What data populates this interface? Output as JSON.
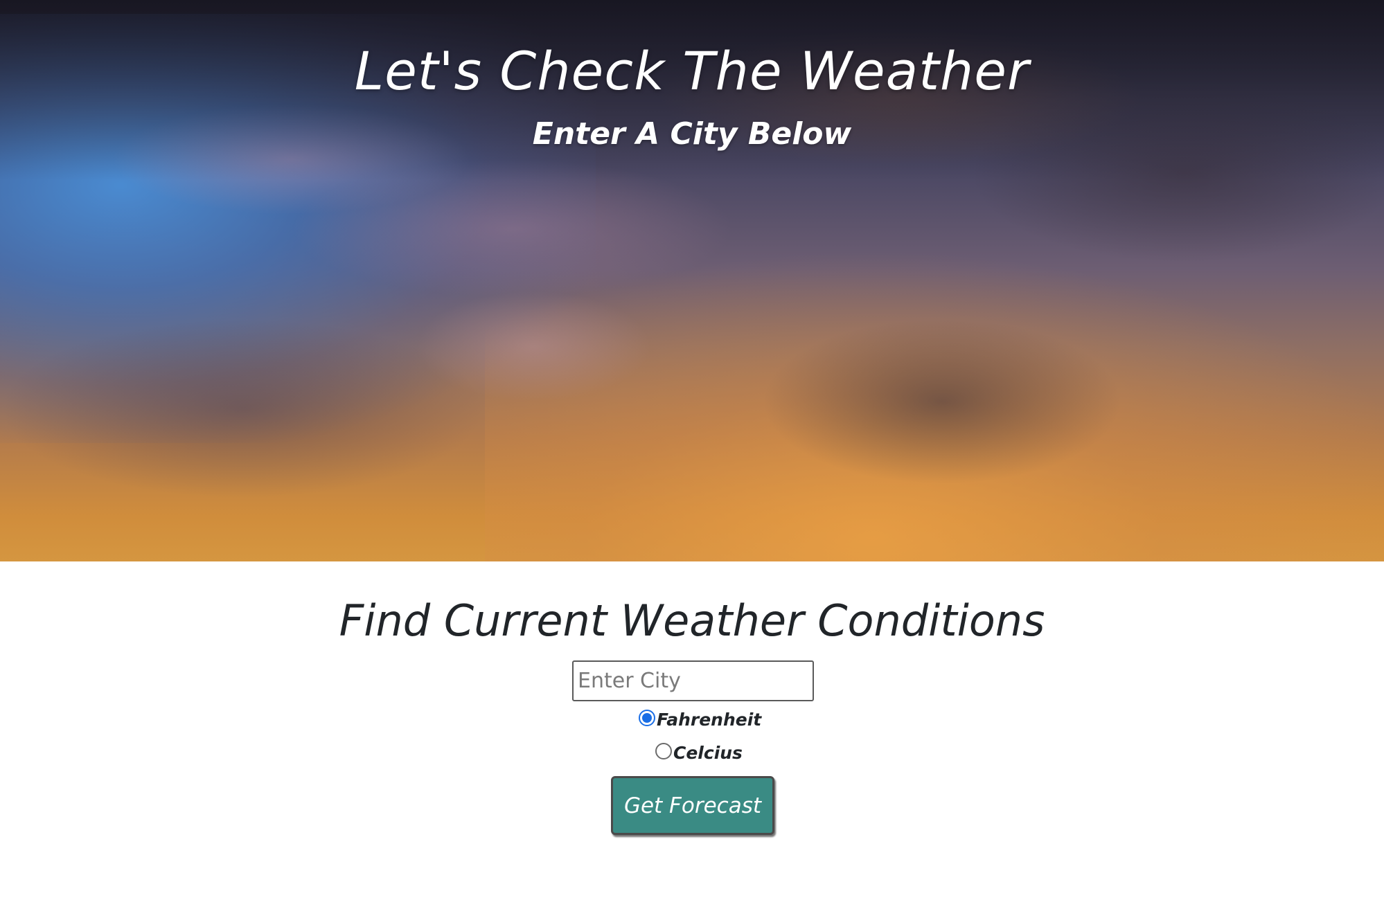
{
  "hero": {
    "title": "Let's Check The Weather",
    "subtitle": "Enter A City Below"
  },
  "main": {
    "heading": "Find Current Weather Conditions",
    "city_input": {
      "value": "",
      "placeholder": "Enter City"
    },
    "units": {
      "options": [
        {
          "label": "Fahrenheit",
          "checked": true
        },
        {
          "label": "Celcius",
          "checked": false
        }
      ]
    },
    "submit_label": "Get Forecast"
  },
  "colors": {
    "button_bg": "#3a8b84",
    "text_dark": "#212529",
    "radio_accent": "#1a6ee6"
  }
}
